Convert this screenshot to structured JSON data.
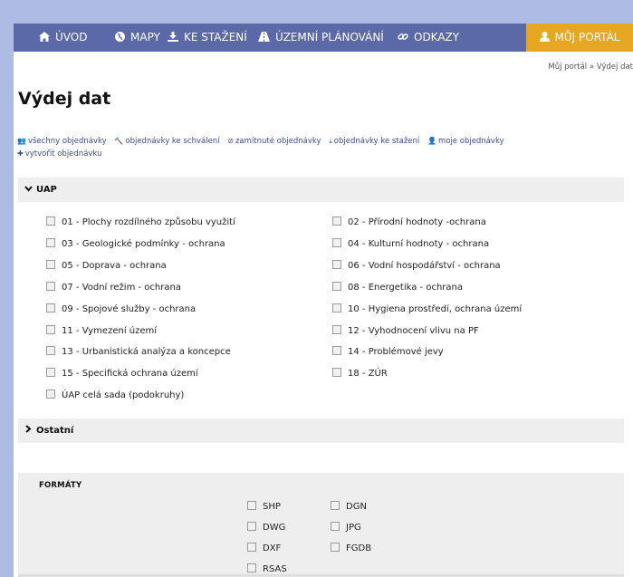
{
  "nav": {
    "items": [
      {
        "label": "ÚVOD",
        "icon": "home-icon"
      },
      {
        "label": "MAPY",
        "icon": "globe-icon"
      },
      {
        "label": "KE STAŽENÍ",
        "icon": "download-icon"
      },
      {
        "label": "ÚZEMNÍ PLÁNOVÁNÍ",
        "icon": "road-icon"
      },
      {
        "label": "ODKAZY",
        "icon": "link-icon"
      }
    ],
    "portal": {
      "label": "MŮJ PORTÁL",
      "icon": "user-icon"
    }
  },
  "breadcrumb": "Můj portál » Výdej dat",
  "page_title": "Výdej dat",
  "actions": [
    {
      "label": "všechny objednávky",
      "icon": "users-icon"
    },
    {
      "label": "objednávky ke schválení",
      "icon": "gavel-icon"
    },
    {
      "label": "zamítnuté objednávky",
      "icon": "ban-icon"
    },
    {
      "label": "objednávky ke stažení",
      "icon": "download-icon"
    },
    {
      "label": "moje objednávky",
      "icon": "user-icon"
    },
    {
      "label": "vytvořit objednávku",
      "icon": "plus-icon"
    }
  ],
  "sections": {
    "uap": {
      "label": "UAP",
      "expanded": true
    },
    "ostatni": {
      "label": "Ostatní",
      "expanded": false
    }
  },
  "uap_items": [
    "01 - Plochy rozdílného způsobu využití",
    "02 - Přírodní hodnoty -ochrana",
    "03 - Geologické podmínky - ochrana",
    "04 - Kulturní hodnoty - ochrana",
    "05 - Doprava - ochrana",
    "06 - Vodní hospodářství - ochrana",
    "07 - Vodní režim - ochrana",
    "08 - Energetika - ochrana",
    "09 - Spojové služby - ochrana",
    "10 - Hygiena prostředí, ochrana území",
    "11 - Vymezení území",
    "12 - Vyhodnocení vlivu na PF",
    "13 - Urbanistická analýza a koncepce",
    "14 - Problémové jevy",
    "15 - Specifická ochrana území",
    "18 - ZÚR",
    "ÚAP celá sada (podokruhy)"
  ],
  "formats": {
    "title": "FORMÁTY",
    "items": [
      "SHP",
      "DGN",
      "DWG",
      "JPG",
      "DXF",
      "FGDB",
      "RSAS"
    ]
  },
  "colors": {
    "nav_bg": "#5c69a8",
    "portal_bg": "#e7a722",
    "page_bg": "#aebbe3",
    "link": "#3d4b8f"
  }
}
